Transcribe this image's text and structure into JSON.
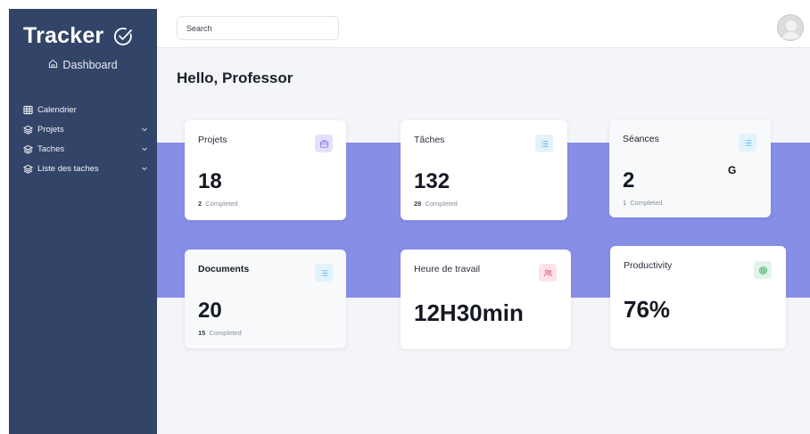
{
  "app": {
    "brand": "Tracker",
    "dashboard_label": "Dashboard"
  },
  "sidebar": {
    "items": [
      {
        "label": "Calendrier",
        "icon": "calendar-icon",
        "has_chevron": false
      },
      {
        "label": "Projets",
        "icon": "layers-icon",
        "has_chevron": true
      },
      {
        "label": "Taches",
        "icon": "layers-icon",
        "has_chevron": true
      },
      {
        "label": "Liste des taches",
        "icon": "layers-icon",
        "has_chevron": true
      }
    ]
  },
  "header": {
    "search_placeholder": "Search"
  },
  "main": {
    "greeting": "Hello, Professor",
    "cards": {
      "projets": {
        "title": "Projets",
        "value": "18",
        "completed_count": "2",
        "completed_label": "Completed",
        "icon": "briefcase-icon"
      },
      "taches": {
        "title": "Tâches",
        "value": "132",
        "completed_count": "28",
        "completed_label": "Completed",
        "icon": "list-icon"
      },
      "seances": {
        "title": "Séances",
        "value": "2",
        "completed_count": "1",
        "completed_label": "Completed",
        "icon": "list-icon",
        "glyph": "G"
      },
      "documents": {
        "title": "Documents",
        "value": "20",
        "completed_count": "15",
        "completed_label": "Completed",
        "icon": "list-icon"
      },
      "heure": {
        "title": "Heure de travail",
        "value": "12H30min",
        "icon": "users-icon"
      },
      "productivity": {
        "title": "Productivity",
        "value": "76%",
        "icon": "target-icon"
      }
    }
  },
  "colors": {
    "sidebar_bg": "#324467",
    "band": "#878ee7",
    "badge_purple": "#e5e0fa",
    "badge_blue": "#e3f3fb",
    "badge_red": "#fbe3e7",
    "badge_green": "#e2f3e8"
  }
}
